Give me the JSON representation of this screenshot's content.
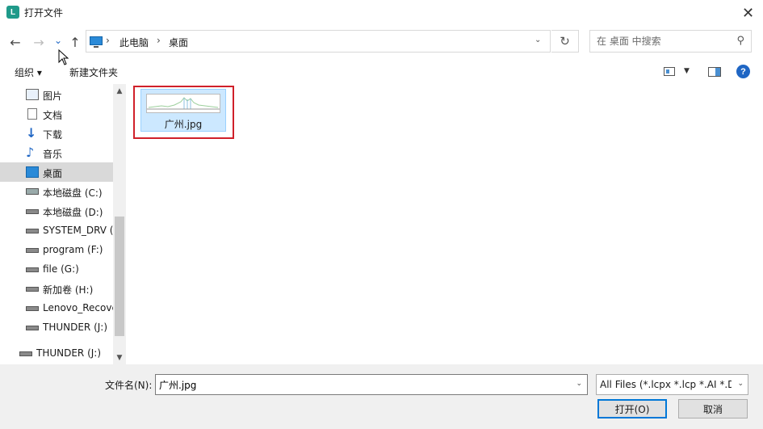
{
  "window": {
    "title": "打开文件",
    "app_icon_letter": "L",
    "close_glyph": "✕"
  },
  "navigation": {
    "back_glyph": "←",
    "forward_glyph": "→",
    "recent_glyph": "⌄",
    "up_glyph": "↑",
    "breadcrumb": [
      "此电脑",
      "桌面"
    ],
    "breadcrumb_sep": "›",
    "dropdown_glyph": "⌄",
    "refresh_glyph": "↻"
  },
  "search": {
    "placeholder": "在 桌面 中搜索",
    "icon_glyph": "⚲"
  },
  "toolbar": {
    "organize_label": "组织 ▾",
    "new_folder_label": "新建文件夹",
    "view_drop_glyph": "▼",
    "help_glyph": "?"
  },
  "sidebar": {
    "items": [
      {
        "label": "图片",
        "icon": "pictures-icon"
      },
      {
        "label": "文档",
        "icon": "documents-icon"
      },
      {
        "label": "下载",
        "icon": "downloads-icon"
      },
      {
        "label": "音乐",
        "icon": "music-icon"
      },
      {
        "label": "桌面",
        "icon": "desktop-icon",
        "selected": true
      },
      {
        "label": "本地磁盘 (C:)",
        "icon": "system-drive-icon"
      },
      {
        "label": "本地磁盘 (D:)",
        "icon": "drive-icon"
      },
      {
        "label": "SYSTEM_DRV (",
        "icon": "drive-icon"
      },
      {
        "label": "program (F:)",
        "icon": "drive-icon"
      },
      {
        "label": "file (G:)",
        "icon": "drive-icon"
      },
      {
        "label": "新加卷 (H:)",
        "icon": "drive-icon"
      },
      {
        "label": "Lenovo_Recove",
        "icon": "drive-icon"
      },
      {
        "label": "THUNDER (J:)",
        "icon": "drive-icon"
      }
    ],
    "bottom_item": {
      "label": "THUNDER (J:)",
      "icon": "drive-icon"
    },
    "scroll_up_glyph": "▲",
    "scroll_down_glyph": "▼"
  },
  "files": [
    {
      "name": "广州.jpg",
      "selected": true
    }
  ],
  "footer": {
    "filename_label": "文件名(N):",
    "filename_value": "广州.jpg",
    "filter_text": "All Files (*.lcpx *.lcp *.AI *.DX",
    "dropdown_glyph": "⌄",
    "open_label": "打开(O)",
    "cancel_label": "取消"
  },
  "colors": {
    "accent": "#0078d7",
    "selection_bg": "#cce8ff",
    "highlight_border": "#d0202a"
  }
}
